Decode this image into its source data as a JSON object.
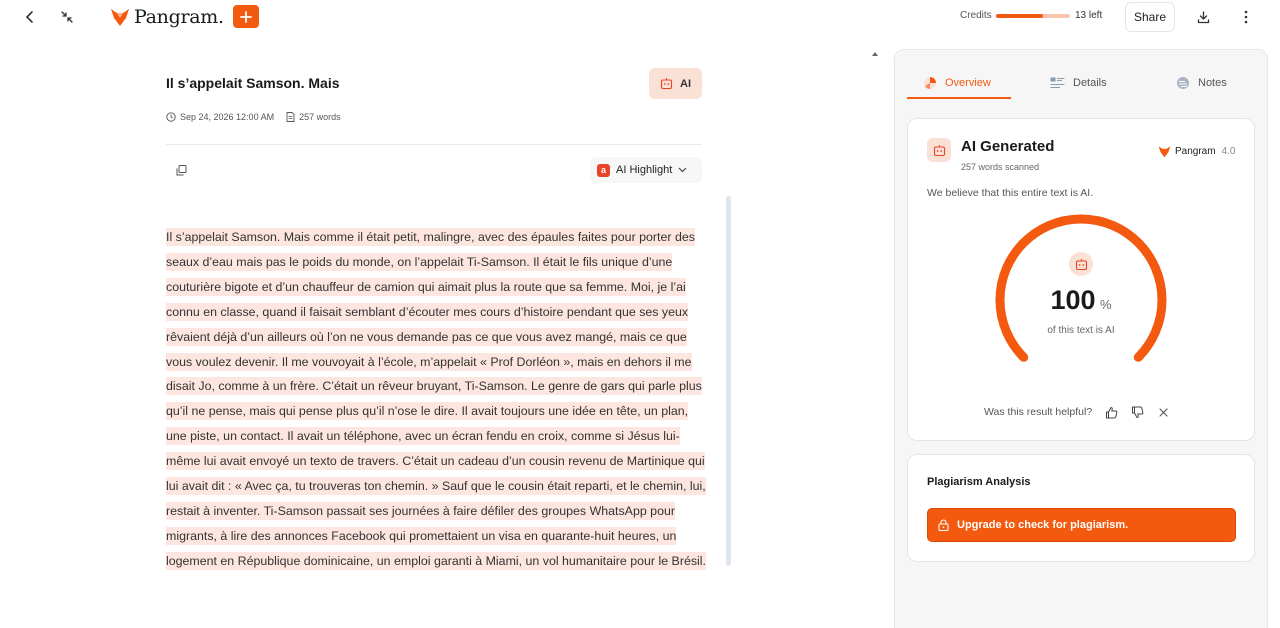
{
  "topbar": {
    "logo_text": "Pangram.",
    "credits_label": "Credits",
    "credits_fill_fraction": 0.63,
    "credits_left": "13 left",
    "share_label": "Share"
  },
  "document": {
    "title": "Il s’appelait Samson. Mais",
    "ai_badge": "AI",
    "date": "Sep 24, 2026 12:00 AM",
    "word_count": "257 words",
    "highlight_label": "AI Highlight",
    "highlight_letter": "a",
    "paragraph": "Il s’appelait Samson. Mais comme il était petit, malingre, avec des épaules faites pour porter des seaux d’eau mais pas le poids du monde, on l’appelait Ti-Samson. Il était le fils unique d’une couturière bigote et d’un chauffeur de camion qui aimait plus la route que sa femme. Moi, je l’ai connu en classe, quand il faisait semblant d’écouter mes cours d’histoire pendant que ses yeux rêvaient déjà d’un ailleurs où l’on ne vous demande pas ce que vous avez mangé, mais ce que vous voulez devenir. Il me vouvoyait à l’école, m’appelait « Prof Dorléon », mais en dehors il me disait Jo, comme à un frère. C’était un rêveur bruyant, Ti-Samson. Le genre de gars qui parle plus qu’il ne pense, mais qui pense plus qu’il n’ose le dire. Il avait toujours une idée en tête, un plan, une piste, un contact. Il avait un téléphone, avec un écran fendu en croix, comme si Jésus lui-même lui avait envoyé un texto de travers. C’était un cadeau d’un cousin revenu de Martinique qui lui avait dit : « Avec ça, tu trouveras ton chemin. » Sauf que le cousin était reparti, et le chemin, lui, restait à inventer. Ti-Samson passait ses journées à faire défiler des groupes WhatsApp pour migrants, à lire des annonces Facebook qui promettaient un visa en quarante-huit heures, un logement en République dominicaine, un emploi garanti à Miami, un vol humanitaire pour le Brésil."
  },
  "panel": {
    "tabs": [
      {
        "label": "Overview"
      },
      {
        "label": "Details"
      },
      {
        "label": "Notes"
      }
    ],
    "result": {
      "heading": "AI Generated",
      "scanned": "257 words scanned",
      "brand": "Pangram",
      "version": "4.0",
      "statement": "We believe that this entire text is AI.",
      "percent": "100",
      "percent_sign": "%",
      "percent_value": 100,
      "subtext": "of this text is AI",
      "helpful_question": "Was this result helpful?"
    },
    "plagiarism": {
      "title": "Plagiarism Analysis",
      "button_label": "Upgrade to check for plagiarism."
    }
  },
  "colors": {
    "accent": "#f45a0f",
    "highlight": "#fde6df",
    "badge_bg": "#fbe0d6"
  }
}
